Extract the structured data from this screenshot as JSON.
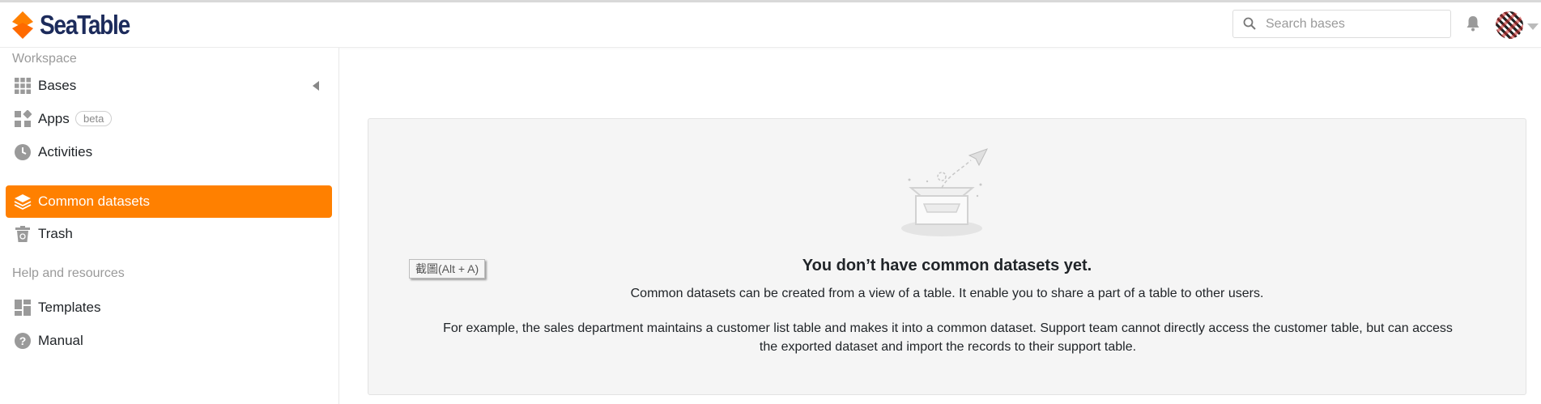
{
  "header": {
    "brand": "SeaTable",
    "search_placeholder": "Search bases"
  },
  "sidebar": {
    "workspace_title": "Workspace",
    "items": [
      {
        "label": "Bases",
        "icon": "grid-icon"
      },
      {
        "label": "Apps",
        "icon": "apps-icon",
        "badge": "beta"
      },
      {
        "label": "Activities",
        "icon": "clock-icon"
      },
      {
        "label": "Common datasets",
        "icon": "layers-icon",
        "active": true
      },
      {
        "label": "Trash",
        "icon": "trash-icon"
      }
    ],
    "help_title": "Help and resources",
    "help_items": [
      {
        "label": "Templates",
        "icon": "templates-icon"
      },
      {
        "label": "Manual",
        "icon": "question-icon"
      }
    ]
  },
  "main": {
    "empty_title": "You don’t have common datasets yet.",
    "empty_description": "Common datasets can be created from a view of a table. It enable you to share a part of a table to other users.",
    "empty_example": "For example, the sales department maintains a customer list table and makes it into a common dataset. Support team cannot directly access the customer table, but can access the exported dataset and import the records to their support table."
  },
  "tooltip": "截圖(Alt + A)",
  "colors": {
    "accent": "#ff8000",
    "brand_text": "#1c2b5b",
    "panel_bg": "#f5f5f5"
  }
}
